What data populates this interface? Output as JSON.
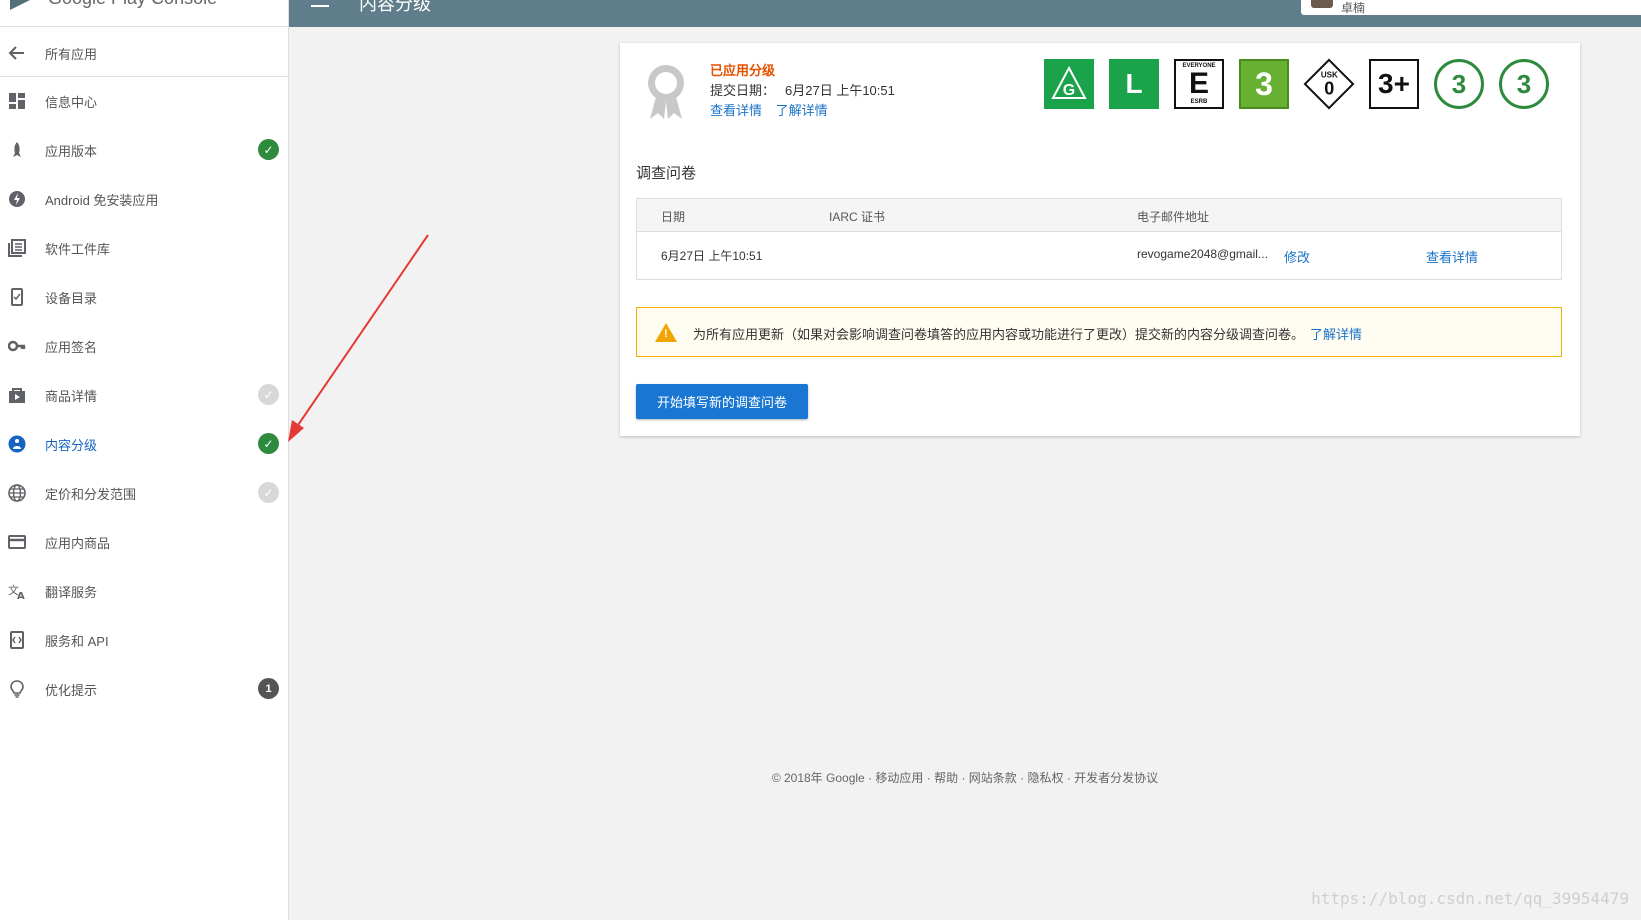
{
  "app": {
    "brand": "Google Play Console",
    "page_title": "内容分级",
    "user_name": "卓楠"
  },
  "sidebar": {
    "back_label": "所有应用",
    "items": [
      {
        "label": "信息中心",
        "icon": "dashboard-icon",
        "status": null
      },
      {
        "label": "应用版本",
        "icon": "rocket-icon",
        "status": "ok"
      },
      {
        "label": "Android 免安装应用",
        "icon": "lightning-icon",
        "status": null
      },
      {
        "label": "软件工件库",
        "icon": "library-icon",
        "status": null
      },
      {
        "label": "设备目录",
        "icon": "device-icon",
        "status": null
      },
      {
        "label": "应用签名",
        "icon": "key-icon",
        "status": null
      },
      {
        "label": "商品详情",
        "icon": "store-listing-icon",
        "status": "done"
      },
      {
        "label": "内容分级",
        "icon": "content-rating-icon",
        "status": "ok",
        "active": true
      },
      {
        "label": "定价和分发范围",
        "icon": "globe-icon",
        "status": "done"
      },
      {
        "label": "应用内商品",
        "icon": "credit-card-icon",
        "status": null
      },
      {
        "label": "翻译服务",
        "icon": "translate-icon",
        "status": null
      },
      {
        "label": "服务和 API",
        "icon": "api-icon",
        "status": null
      },
      {
        "label": "优化提示",
        "icon": "lightbulb-icon",
        "status": "1"
      }
    ]
  },
  "rating": {
    "status_label": "已应用分级",
    "submit_label": "提交日期：",
    "submit_date": "6月27日 上午10:51",
    "view_details": "查看详情",
    "learn_more": "了解详情",
    "badges": {
      "g": "G",
      "l": "L",
      "esrb_top": "EVERYONE",
      "esrb_letter": "E",
      "esrb_bottom": "ESRB",
      "pegi": "3",
      "usk_label": "USK",
      "usk_value": "0",
      "iarc": "3+",
      "circle1": "3",
      "circle2": "3"
    }
  },
  "questionnaire": {
    "title": "调查问卷",
    "columns": [
      "日期",
      "IARC 证书",
      "电子邮件地址"
    ],
    "row": {
      "date": "6月27日 上午10:51",
      "certificate": "",
      "email": "revogame2048@gmail...",
      "edit": "修改",
      "view": "查看详情"
    }
  },
  "warning": {
    "text": "为所有应用更新（如果对会影响调查问卷填答的应用内容或功能进行了更改）提交新的内容分级调查问卷。",
    "link": "了解详情"
  },
  "start_button": "开始填写新的调查问卷",
  "footer": {
    "copyright": "© 2018年 Google",
    "links": [
      "移动应用",
      "帮助",
      "网站条款",
      "隐私权",
      "开发者分发协议"
    ]
  },
  "watermark": "https://blog.csdn.net/qq_39954479",
  "colors": {
    "topbar": "#607d8b",
    "accent": "#1976d2",
    "ok_green": "#2e8b3e",
    "warning": "#f0a500",
    "arrow": "#e53935"
  }
}
